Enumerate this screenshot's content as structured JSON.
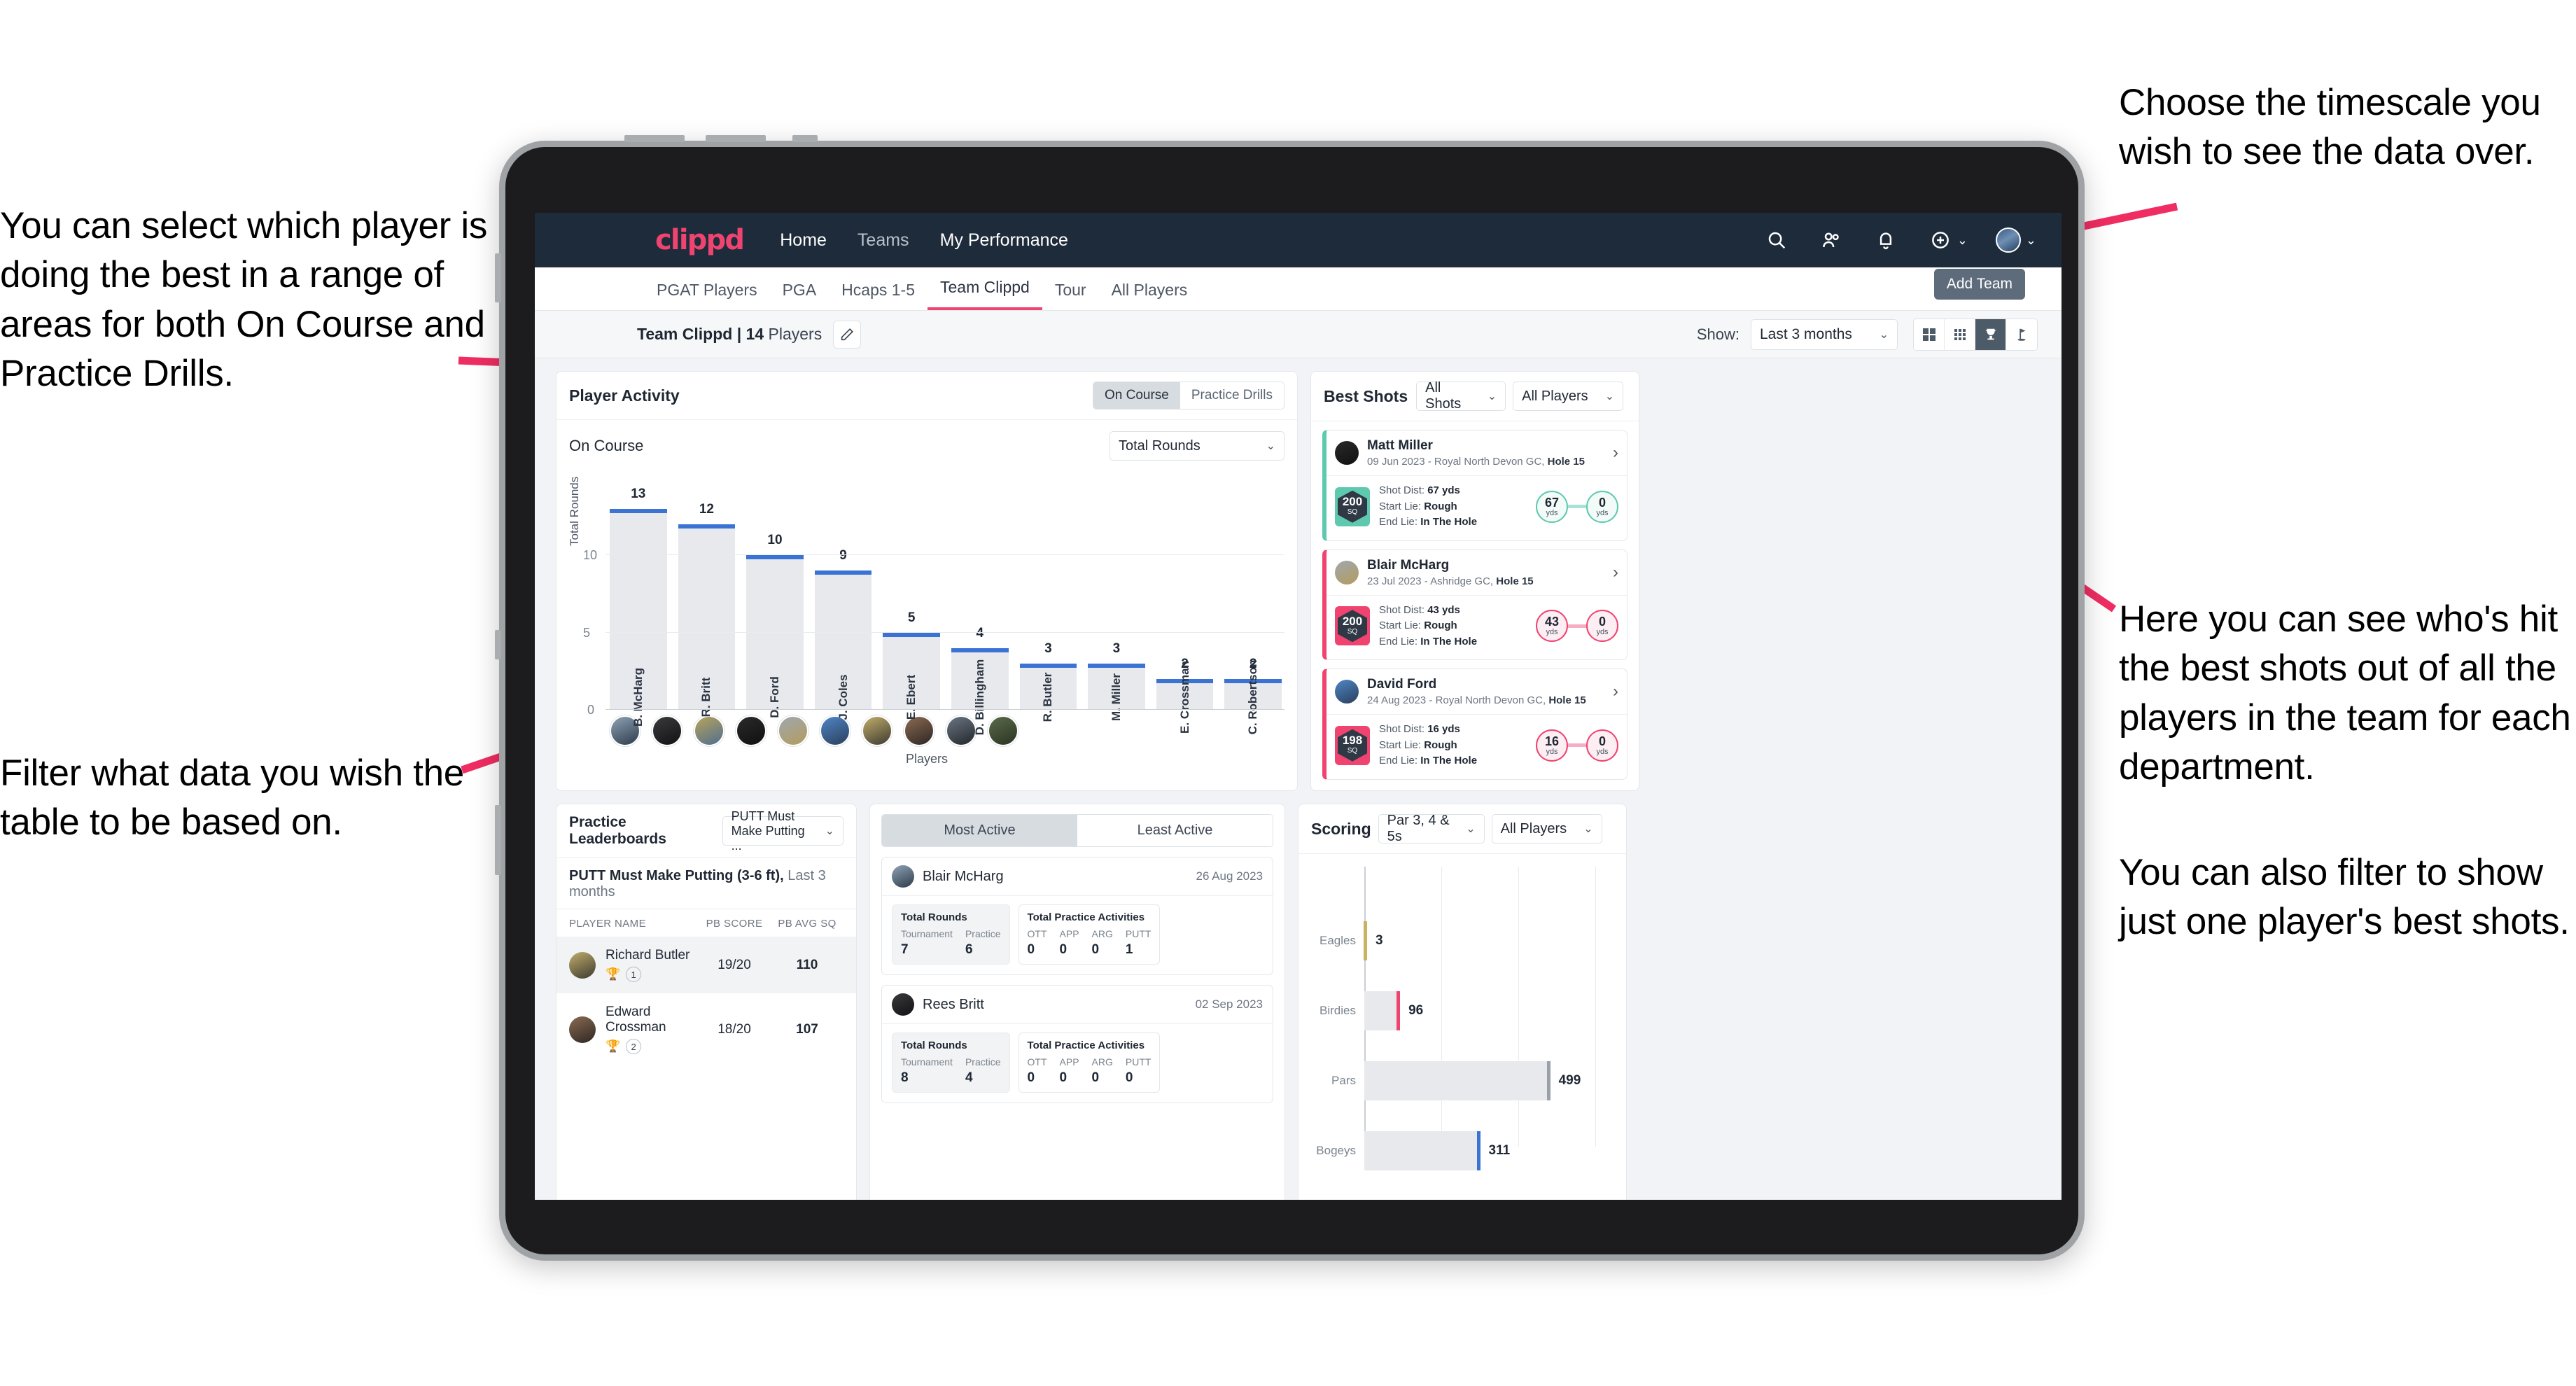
{
  "annotations": {
    "left_top": "You can select which player is doing the best in a range of areas for both On Course and Practice Drills.",
    "left_bottom": "Filter what data you wish the table to be based on.",
    "right_top": "Choose the timescale you wish to see the data over.",
    "right_mid": "Here you can see who's hit the best shots out of all the players in the team for each department.",
    "right_bottom": "You can also filter to show just one player's best shots."
  },
  "colors": {
    "brand_pink": "#ef4370",
    "nav_dark": "#1d2b3a",
    "bar_blue": "#3b73d4",
    "teal": "#5fc9b0"
  },
  "topnav": {
    "logo": "clippd",
    "links": [
      {
        "label": "Home"
      },
      {
        "label": "Teams"
      },
      {
        "label": "My Performance"
      }
    ],
    "icons": [
      "search-icon",
      "people-icon",
      "bell-icon",
      "plus-circle-icon",
      "avatar"
    ]
  },
  "tabs": [
    {
      "label": "PGAT Players",
      "active": false
    },
    {
      "label": "PGA",
      "active": false
    },
    {
      "label": "Hcaps 1-5",
      "active": false
    },
    {
      "label": "Team Clippd",
      "active": true
    },
    {
      "label": "Tour",
      "active": false
    },
    {
      "label": "All Players",
      "active": false
    }
  ],
  "tooltip": {
    "add_team": "Add Team"
  },
  "subheader": {
    "team_name": "Team Clippd",
    "team_separator": " | ",
    "player_count": "14",
    "players_word": " Players",
    "show_label": "Show:",
    "period_value": "Last 3 months",
    "view_icons": [
      "grid-large-icon",
      "grid-small-icon",
      "trophy-icon",
      "golf-flag-icon"
    ]
  },
  "player_activity": {
    "title": "Player Activity",
    "segments": [
      {
        "label": "On Course",
        "selected": true
      },
      {
        "label": "Practice Drills",
        "selected": false
      }
    ],
    "sub_label": "On Course",
    "metric_select": "Total Rounds"
  },
  "best_shots": {
    "title": "Best Shots",
    "shot_filter": "All Shots",
    "player_filter": "All Players",
    "cards": [
      {
        "name": "Matt Miller",
        "meta_prefix": "09 Jun 2023 - Royal North Devon GC, ",
        "hole": "Hole 15",
        "sq": "200",
        "sq_unit": "SQ",
        "accent": "teal",
        "shot_dist_label": "Shot Dist: ",
        "shot_dist": "67 yds",
        "start_lie_label": "Start Lie: ",
        "start_lie": "Rough",
        "end_lie_label": "End Lie: ",
        "end_lie": "In The Hole",
        "from_val": "67",
        "from_unit": "yds",
        "to_val": "0",
        "to_unit": "yds"
      },
      {
        "name": "Blair McHarg",
        "meta_prefix": "23 Jul 2023 - Ashridge GC, ",
        "hole": "Hole 15",
        "sq": "200",
        "sq_unit": "SQ",
        "accent": "pink",
        "shot_dist_label": "Shot Dist: ",
        "shot_dist": "43 yds",
        "start_lie_label": "Start Lie: ",
        "start_lie": "Rough",
        "end_lie_label": "End Lie: ",
        "end_lie": "In The Hole",
        "from_val": "43",
        "from_unit": "yds",
        "to_val": "0",
        "to_unit": "yds"
      },
      {
        "name": "David Ford",
        "meta_prefix": "24 Aug 2023 - Royal North Devon GC, ",
        "hole": "Hole 15",
        "sq": "198",
        "sq_unit": "SQ",
        "accent": "pink",
        "shot_dist_label": "Shot Dist: ",
        "shot_dist": "16 yds",
        "start_lie_label": "Start Lie: ",
        "start_lie": "Rough",
        "end_lie_label": "End Lie: ",
        "end_lie": "In The Hole",
        "from_val": "16",
        "from_unit": "yds",
        "to_val": "0",
        "to_unit": "yds"
      }
    ]
  },
  "practice_leaderboards": {
    "title": "Practice Leaderboards",
    "drill_select": "PUTT Must Make Putting ...",
    "sub_title": "PUTT Must Make Putting (3-6 ft),",
    "sub_period": " Last 3 months",
    "columns": [
      "PLAYER NAME",
      "PB SCORE",
      "PB AVG SQ"
    ],
    "rows": [
      {
        "name": "Richard Butler",
        "rank": "1",
        "trophy": "gold",
        "pb_score": "19/20",
        "pb_avg_sq": "110",
        "highlight": true
      },
      {
        "name": "Edward Crossman",
        "rank": "2",
        "trophy": "silver",
        "pb_score": "18/20",
        "pb_avg_sq": "107",
        "highlight": false
      }
    ]
  },
  "activity": {
    "tabs": [
      {
        "label": "Most Active",
        "selected": true
      },
      {
        "label": "Least Active",
        "selected": false
      }
    ],
    "cards": [
      {
        "name": "Blair McHarg",
        "date": "26 Aug 2023",
        "rounds_title": "Total Rounds",
        "rounds": [
          {
            "key": "Tournament",
            "value": "7"
          },
          {
            "key": "Practice",
            "value": "6"
          }
        ],
        "practice_title": "Total Practice Activities",
        "practice": [
          {
            "key": "OTT",
            "value": "0"
          },
          {
            "key": "APP",
            "value": "0"
          },
          {
            "key": "ARG",
            "value": "0"
          },
          {
            "key": "PUTT",
            "value": "1"
          }
        ]
      },
      {
        "name": "Rees Britt",
        "date": "02 Sep 2023",
        "rounds_title": "Total Rounds",
        "rounds": [
          {
            "key": "Tournament",
            "value": "8"
          },
          {
            "key": "Practice",
            "value": "4"
          }
        ],
        "practice_title": "Total Practice Activities",
        "practice": [
          {
            "key": "OTT",
            "value": "0"
          },
          {
            "key": "APP",
            "value": "0"
          },
          {
            "key": "ARG",
            "value": "0"
          },
          {
            "key": "PUTT",
            "value": "0"
          }
        ]
      }
    ]
  },
  "scoring": {
    "title": "Scoring",
    "par_select": "Par 3, 4 & 5s",
    "player_select": "All Players"
  },
  "chart_data": [
    {
      "type": "bar",
      "title": "Player Activity - On Course",
      "xlabel": "Players",
      "ylabel": "Total Rounds",
      "ylim": [
        0,
        13
      ],
      "yticks": [
        0,
        5,
        10
      ],
      "grid": true,
      "categories": [
        "B. McHarg",
        "R. Britt",
        "D. Ford",
        "J. Coles",
        "E. Ebert",
        "D. Billingham",
        "R. Butler",
        "M. Miller",
        "E. Crossman",
        "C. Robertson"
      ],
      "values": [
        13,
        12,
        10,
        9,
        5,
        4,
        3,
        3,
        2,
        2
      ],
      "bar_color": "#e7e9ec",
      "cap_color": "#3b73d4"
    },
    {
      "type": "bar",
      "orientation": "horizontal",
      "title": "Scoring",
      "categories": [
        "Eagles",
        "Birdies",
        "Pars",
        "Bogeys"
      ],
      "values": [
        3,
        96,
        499,
        311
      ],
      "xlim": [
        0,
        600
      ],
      "cap_colors": [
        "#c8b35e",
        "#ef4370",
        "#9aa0a8",
        "#3b73d4"
      ],
      "bar_color": "#e7e9ec",
      "grid": true
    }
  ]
}
